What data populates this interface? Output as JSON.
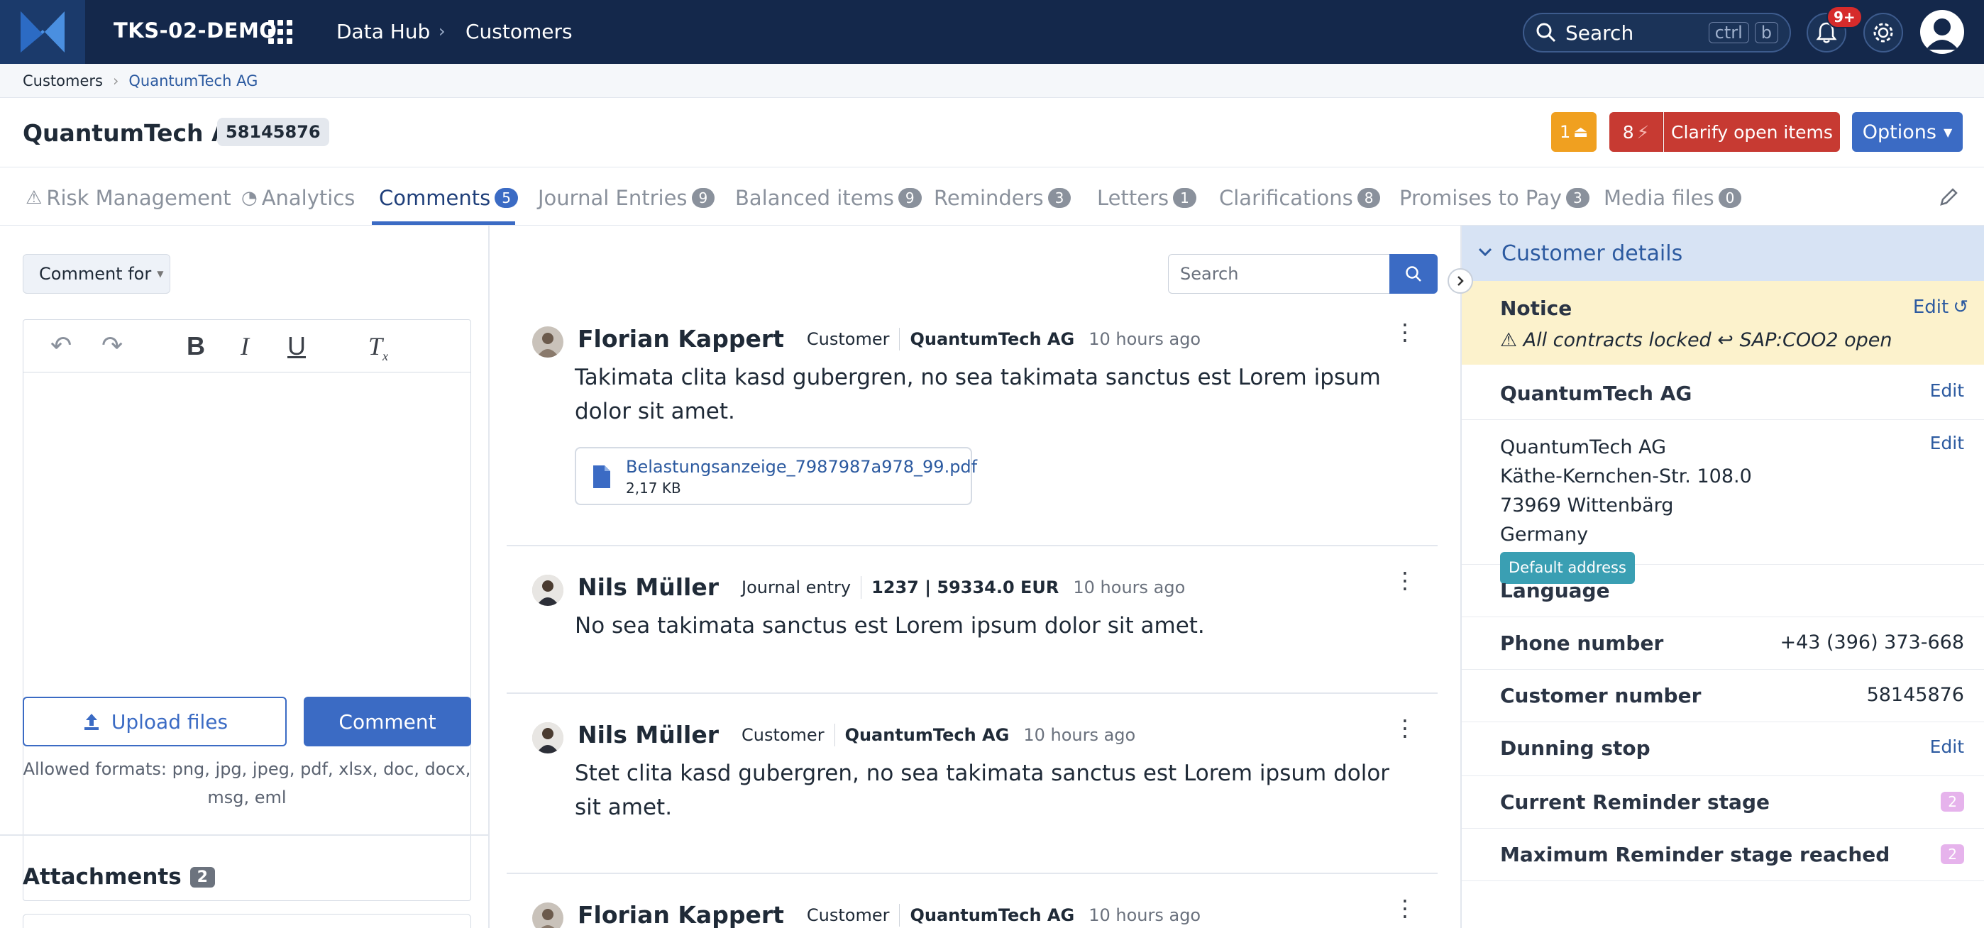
{
  "topbar": {
    "app_name": "TKS-02-DEMO",
    "crumb_1": "Data Hub",
    "crumb_2": "Customers",
    "search_label": "Search",
    "kbd_1": "ctrl",
    "kbd_2": "b",
    "notif_count": "9+"
  },
  "breadcrumb": {
    "item_1": "Customers",
    "item_2": "QuantumTech AG"
  },
  "header": {
    "title": "QuantumTech AG",
    "id": "58145876",
    "warn_count": "1",
    "open_count": "8",
    "clarify_label": "Clarify open items",
    "options_label": "Options"
  },
  "tabs": [
    {
      "label": "Risk Management",
      "count": ""
    },
    {
      "label": "Analytics",
      "count": ""
    },
    {
      "label": "Comments",
      "count": "5"
    },
    {
      "label": "Journal Entries",
      "count": "9"
    },
    {
      "label": "Balanced items",
      "count": "9"
    },
    {
      "label": "Reminders",
      "count": "3"
    },
    {
      "label": "Letters",
      "count": "1"
    },
    {
      "label": "Clarifications",
      "count": "8"
    },
    {
      "label": "Promises to Pay",
      "count": "3"
    },
    {
      "label": "Media files",
      "count": "0"
    }
  ],
  "composer": {
    "comment_for": "Comment for",
    "upload_label": "Upload files",
    "comment_label": "Comment",
    "formats": "Allowed formats: png, jpg, jpeg, pdf, xlsx, doc, docx, msg, eml",
    "attachments_title": "Attachments",
    "attachments_count": "2"
  },
  "search": {
    "placeholder": "Search"
  },
  "comments": [
    {
      "author": "Florian Kappert",
      "tag": "Customer",
      "ref": "QuantumTech AG",
      "time": "10 hours ago",
      "text": "Takimata clita kasd gubergren, no sea takimata sanctus est Lorem ipsum dolor sit amet.",
      "file_name": "Belastungsanzeige_7987987a978_99.pdf",
      "file_size": "2,17 KB"
    },
    {
      "author": "Nils Müller",
      "tag": "Journal entry",
      "ref": "1237 | 59334.0 EUR",
      "time": "10 hours ago",
      "text": "No sea takimata sanctus est Lorem ipsum dolor sit amet."
    },
    {
      "author": "Nils Müller",
      "tag": "Customer",
      "ref": "QuantumTech AG",
      "time": "10 hours ago",
      "text": "Stet clita kasd gubergren, no sea takimata sanctus est Lorem ipsum dolor sit amet."
    },
    {
      "author": "Florian Kappert",
      "tag": "Customer",
      "ref": "QuantumTech AG",
      "time": "10 hours ago"
    }
  ],
  "details": {
    "title": "Customer details",
    "notice_label": "Notice",
    "notice_edit": "Edit",
    "notice_text": "⚠ All contracts locked ↩ SAP:COO2 open",
    "company": "QuantumTech AG",
    "edit": "Edit",
    "address_lines": [
      "QuantumTech AG",
      "Käthe-Kernchen-Str. 108.0",
      "73969 Wittenbärg",
      "Germany"
    ],
    "default_address": "Default address",
    "language_label": "Language",
    "phone_label": "Phone number",
    "phone_value": "+43 (396) 373-668",
    "custnum_label": "Customer number",
    "custnum_value": "58145876",
    "dunning_label": "Dunning stop",
    "stage_label": "Current Reminder stage",
    "stage_value": "2",
    "max_stage_label": "Maximum Reminder stage reached",
    "max_stage_value": "2"
  }
}
